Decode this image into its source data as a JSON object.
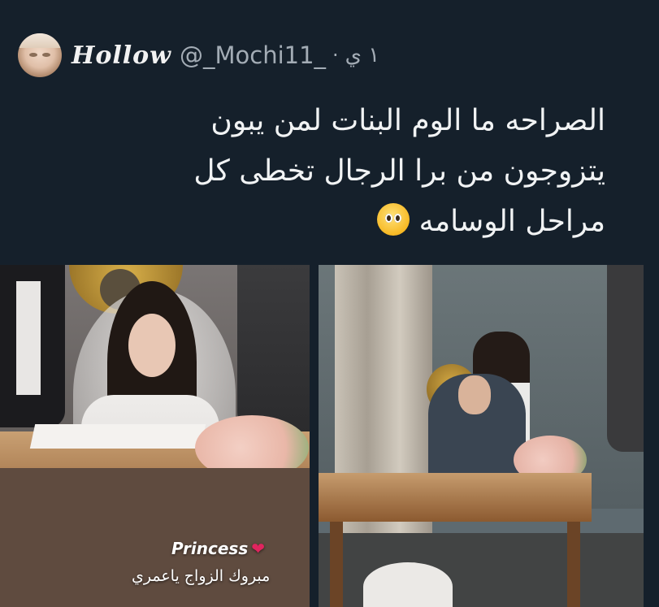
{
  "tweet": {
    "display_name": "Hollow",
    "handle": "@_Mochi11_",
    "separator": "·",
    "time": "١ ي",
    "text_lines": [
      "الصراحه ما الوم البنات لمن يبون",
      "يتزوجون من برا الرجال تخطى كل",
      "مراحل الوسامه"
    ],
    "emoji": "pleading-face-emoji"
  },
  "media": {
    "left_photo": {
      "overlay_title": "Princess",
      "overlay_heart": "❤",
      "overlay_caption": "مبروك الزواج ياعمري"
    },
    "right_photo": {}
  },
  "colors": {
    "background": "#15202b",
    "text": "#e7e9ea",
    "secondary_text": "#a3acb5",
    "heart": "#e0245e"
  }
}
